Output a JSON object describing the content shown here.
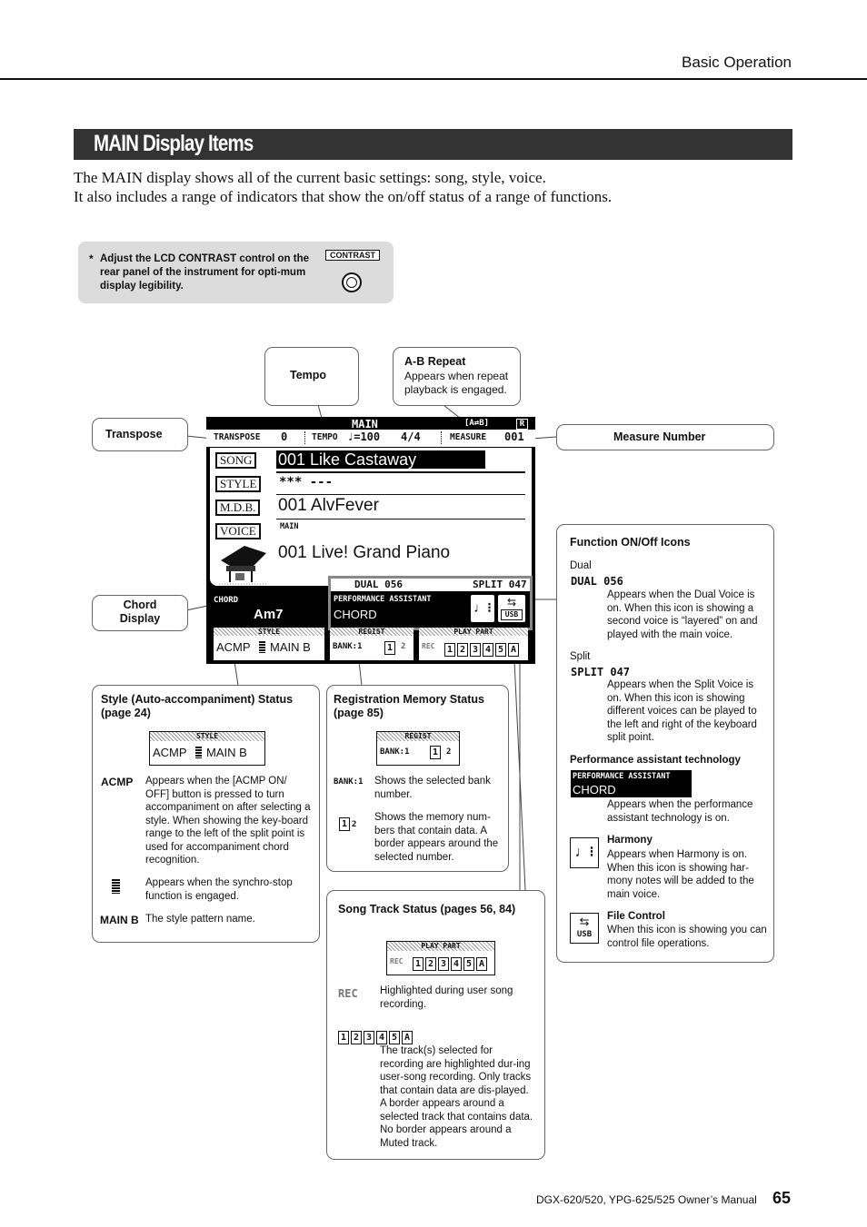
{
  "header": {
    "section": "Basic Operation"
  },
  "title": "MAIN Display Items",
  "intro": [
    "The MAIN display shows all of the current basic settings: song, style, voice.",
    "It also includes a range of indicators that show the on/off status of a range of functions."
  ],
  "note": {
    "star": "*",
    "text": "Adjust the LCD CONTRAST control on the rear panel of the instrument for opti-mum display legibility.",
    "control_label": "CONTRAST"
  },
  "callouts": {
    "tempo": "Tempo",
    "ab_repeat": {
      "title": "A-B Repeat",
      "text": "Appears when repeat playback is engaged."
    },
    "transpose": "Transpose",
    "measure": "Measure Number",
    "chord": "Chord Display"
  },
  "lcd": {
    "title": "MAIN",
    "ab_icon": "[A⇄B]",
    "r_icon": "R",
    "transpose_label": "TRANSPOSE",
    "transpose_value": "0",
    "tempo_label": "TEMPO",
    "tempo_value": "♩=100",
    "time_sig": "4/4",
    "measure_label": "MEASURE",
    "measure_value": "001",
    "song_label": "SONG",
    "song_value": "001 Like Castaway",
    "style_label": "STYLE",
    "style_value": "*** ---",
    "mdb_label": "M.D.B.",
    "mdb_value": "001 AlvFever",
    "voice_label": "VOICE",
    "voice_sub": "MAIN",
    "voice_value": "001 Live! Grand Piano",
    "dual": "DUAL 056",
    "split": "SPLIT 047",
    "chord_label": "CHORD",
    "chord_value": "Am7",
    "pa_label": "PERFORMANCE ASSISTANT",
    "pa_value": "CHORD",
    "usb": "USB",
    "style_hdr": "STYLE",
    "acmp": "ACMP",
    "main_b": "MAIN B",
    "regist_hdr": "REGIST",
    "bank": "BANK:1",
    "mem": [
      "1",
      "2"
    ],
    "play_part_hdr": "PLAY PART",
    "rec": "REC",
    "tracks": [
      "1",
      "2",
      "3",
      "4",
      "5",
      "A"
    ]
  },
  "style_panel": {
    "title": "Style (Auto-accompaniment) Status (page 24)",
    "items": [
      {
        "icon": "ACMP",
        "text": "Appears when the [ACMP ON/ OFF] button is pressed to turn accompaniment on after selecting a style. When showing the key-board range to the left of the split point is used for accompaniment chord recognition."
      },
      {
        "icon": "synchro-stop",
        "text": "Appears when the synchro-stop function is engaged."
      },
      {
        "icon": "MAIN B",
        "text": "The style pattern name."
      }
    ]
  },
  "regist_panel": {
    "title": "Registration Memory Status (page 85)",
    "items": [
      {
        "icon": "BANK:1",
        "text": "Shows the selected bank number."
      },
      {
        "icon": "1 2",
        "text": "Shows the memory num-bers that contain data. A border appears around the selected number."
      }
    ]
  },
  "song_panel": {
    "title": "Song Track Status (pages 56, 84)",
    "items": [
      {
        "icon": "REC",
        "text": "Highlighted during user song recording."
      },
      {
        "icon": "1 2 3 4 5 A",
        "text": "The track(s) selected for recording are highlighted dur-ing user-song recording. Only tracks that contain data are dis-played. A border appears around a selected track that contains data. No border appears around a Muted track."
      }
    ]
  },
  "function_panel": {
    "title": "Function ON/Off Icons",
    "dual": {
      "label": "Dual",
      "icon": "DUAL 056",
      "text": "Appears when the Dual Voice is on. When this icon is showing a second voice is “layered” on and played with the main voice."
    },
    "split": {
      "label": "Split",
      "icon": "SPLIT 047",
      "text": "Appears when the Split Voice is on. When this icon is showing different voices can be played to the left and right of the keyboard split point."
    },
    "pa": {
      "label": "Performance assistant technology",
      "icon_l1": "PERFORMANCE ASSISTANT",
      "icon_l2": "CHORD",
      "text": "Appears when the performance assistant technology is on."
    },
    "harmony": {
      "title": "Harmony",
      "text": "Appears when Harmony is on. When this icon is showing har-mony notes will be added to the main voice."
    },
    "file": {
      "title": "File Control",
      "text": "When this icon is showing you can control file operations.",
      "icon": "USB"
    }
  },
  "footer": {
    "manual": "DGX-620/520, YPG-625/525  Owner’s Manual",
    "page": "65"
  }
}
